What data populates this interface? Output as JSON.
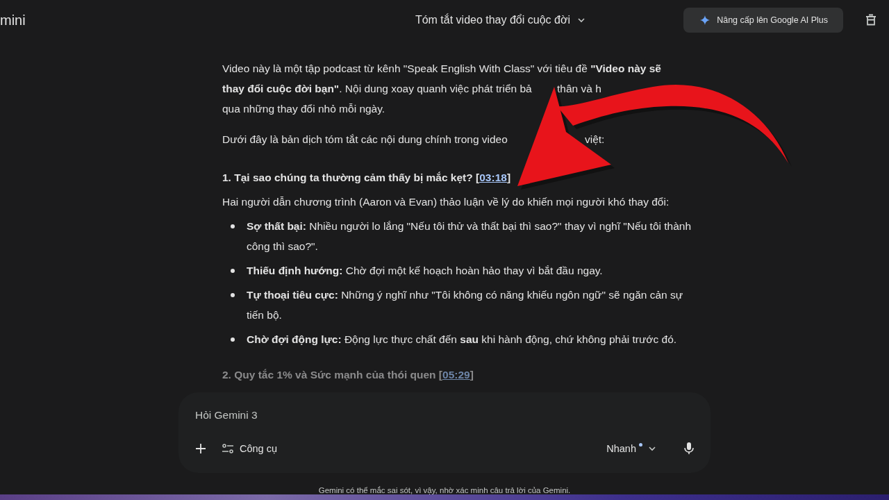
{
  "top_bar": {
    "app_name": "mini",
    "chat_title": "Tóm tắt video thay đổi cuộc đời",
    "upgrade_button": "Nâng cấp lên Google AI Plus"
  },
  "response": {
    "intro_lines": [
      [
        "Video này là một tập podcast từ kênh \"Speak English With Class\" với tiêu đề **\"Video này sẽ**"
      ],
      [
        "**thay đổi cuộc đời bạn\"**. Nội dung xoay quanh việc phát triển bả",
        "thân và h"
      ],
      [
        "qua những thay đổi nhỏ mỗi ngày."
      ]
    ],
    "summary_line": [
      "Dưới đây là bản dịch tóm tắt các nội dung chính trong video",
      "việt:"
    ],
    "sections": [
      {
        "heading": "1. Tại sao chúng ta thường cảm thấy bị mắc kẹt?",
        "open_bracket": "[",
        "timestamp": "03:18",
        "close_bracket": "]",
        "faded": false,
        "lead": "Hai người dẫn chương trình (Aaron và Evan) thảo luận về lý do khiến mọi người khó thay đổi:",
        "bullets": [
          {
            "term": "Sợ thất bại:",
            "text": "Nhiều người lo lắng \"Nếu tôi thử và thất bại thì sao?\" thay vì nghĩ \"Nếu tôi thành công thì sao?\"."
          },
          {
            "term": "Thiếu định hướng:",
            "text": "Chờ đợi một kế hoạch hoàn hảo thay vì bắt đầu ngay."
          },
          {
            "term": "Tự thoại tiêu cực:",
            "text": "Những ý nghĩ như \"Tôi không có năng khiếu ngôn ngữ\" sẽ ngăn cản sự tiến bộ."
          },
          {
            "term": "Chờ đợi động lực:",
            "text": "Động lực thực chất đến **sau** khi hành động, chứ không phải trước đó."
          }
        ]
      },
      {
        "heading": "2. Quy tắc 1% và Sức mạnh của thói quen",
        "open_bracket": "[",
        "timestamp": "05:29",
        "close_bracket": "]",
        "faded": true
      }
    ]
  },
  "composer": {
    "placeholder": "Hỏi Gemini 3",
    "tools_button": "Công cụ",
    "mode_button": "Nhanh"
  },
  "disclaimer": "Gemini có thể mắc sai sót, vì vậy, nhờ xác minh câu trả lời của Gemini."
}
